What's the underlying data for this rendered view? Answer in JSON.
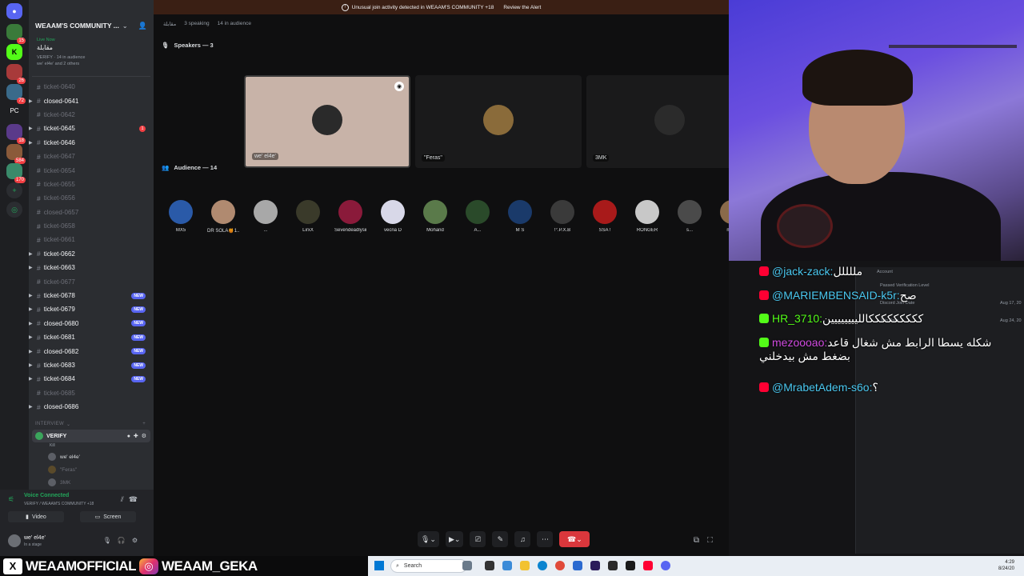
{
  "alert": {
    "text": "Unusual join activity detected in WEAAM'S COMMUNITY +18",
    "action": "Review the Alert"
  },
  "server": {
    "name": "WEAAM'S COMMUNITY ...",
    "live_label": "Live Now",
    "stage_name": "مقابلة",
    "live_meta": "VERIFY · 14 in audience",
    "live_people": "we' el4e' and 2 others"
  },
  "channels": [
    {
      "name": "ticket-0640",
      "bright": false,
      "arrow": false
    },
    {
      "name": "closed-0641",
      "bright": true,
      "arrow": true
    },
    {
      "name": "ticket-0642",
      "bright": false,
      "arrow": false
    },
    {
      "name": "ticket-0645",
      "bright": true,
      "arrow": true,
      "mention": "1"
    },
    {
      "name": "ticket-0646",
      "bright": true,
      "arrow": true
    },
    {
      "name": "ticket-0647",
      "bright": false,
      "arrow": false
    },
    {
      "name": "ticket-0654",
      "bright": false,
      "arrow": false
    },
    {
      "name": "ticket-0655",
      "bright": false,
      "arrow": false
    },
    {
      "name": "ticket-0656",
      "bright": false,
      "arrow": false
    },
    {
      "name": "closed-0657",
      "bright": false,
      "arrow": false
    },
    {
      "name": "ticket-0658",
      "bright": false,
      "arrow": false
    },
    {
      "name": "ticket-0661",
      "bright": false,
      "arrow": false
    },
    {
      "name": "ticket-0662",
      "bright": true,
      "arrow": true
    },
    {
      "name": "ticket-0663",
      "bright": true,
      "arrow": true
    },
    {
      "name": "ticket-0677",
      "bright": false,
      "arrow": false
    },
    {
      "name": "ticket-0678",
      "bright": true,
      "arrow": true,
      "new": "NEW"
    },
    {
      "name": "ticket-0679",
      "bright": true,
      "arrow": true,
      "new": "NEW"
    },
    {
      "name": "closed-0680",
      "bright": true,
      "arrow": true,
      "new": "NEW"
    },
    {
      "name": "ticket-0681",
      "bright": true,
      "arrow": true,
      "new": "NEW"
    },
    {
      "name": "closed-0682",
      "bright": true,
      "arrow": true,
      "new": "NEW"
    },
    {
      "name": "ticket-0683",
      "bright": true,
      "arrow": true,
      "new": "NEW"
    },
    {
      "name": "ticket-0684",
      "bright": true,
      "arrow": true,
      "new": "NEW"
    },
    {
      "name": "ticket-0685",
      "bright": false,
      "arrow": false
    },
    {
      "name": "closed-0686",
      "bright": true,
      "arrow": true
    }
  ],
  "category": "INTERVIEW",
  "voice_channel": {
    "name": "VERIFY",
    "sub": "Kill",
    "users": [
      "we' el4e'",
      "\"Feras\"",
      "3MK"
    ]
  },
  "voice_connected": {
    "status": "Voice Connected",
    "location": "VERIFY / WEAAM'S COMMUNITY +18",
    "video": "Video",
    "screen": "Screen"
  },
  "current_user": {
    "name": "we' el4e'",
    "status": "In a stage"
  },
  "stage": {
    "top_name": "مقابلة",
    "speaking": "3 speaking",
    "audience_count": "14 in audience",
    "speakers_title": "Speakers — 3",
    "audience_title": "Audience — 14",
    "speakers": [
      {
        "name": "we' el4e'",
        "active": true,
        "color": "#2a2a2a"
      },
      {
        "name": "\"Feras\"",
        "active": false,
        "color": "#8a6b3a"
      },
      {
        "name": "3MK",
        "active": false,
        "color": "#2b2b2b"
      }
    ],
    "audience": [
      {
        "name": "MX5",
        "color": "#2a5aa8"
      },
      {
        "name": "DR SOLA🍯1...",
        "color": "#b08a70"
      },
      {
        "name": "...",
        "color": "#a8a8a8"
      },
      {
        "name": "LirxX",
        "color": "#3a3a2a"
      },
      {
        "name": "Sevendeadlysin",
        "color": "#8a1a3a"
      },
      {
        "name": "vecna D",
        "color": "#d8d8e8"
      },
      {
        "name": "Mohand",
        "color": "#5a7a4a"
      },
      {
        "name": "A...",
        "color": "#2a4a2a"
      },
      {
        "name": "M S",
        "color": "#1a3a6a"
      },
      {
        "name": "!°.P.X.B",
        "color": "#3a3a3a"
      },
      {
        "name": "SSA !",
        "color": "#a81a1a"
      },
      {
        "name": "RONGER",
        "color": "#c8c8c8"
      },
      {
        "name": "s...",
        "color": "#4a4a4a"
      },
      {
        "name": "mo...",
        "color": "#8a6a4a"
      }
    ]
  },
  "chat": {
    "messages": [
      {
        "platform": "yt",
        "user": "@jack-zack:",
        "color": "#4ac8f0",
        "text": "مللللل"
      },
      {
        "platform": "yt",
        "user": "@MARIEMBENSAID-k5r:",
        "color": "#4ac8f0",
        "text": "صح"
      },
      {
        "platform": "kick",
        "user": "HR_3710:",
        "color": "#53fc18",
        "text": "كككككككككالليييييييين"
      },
      {
        "platform": "kick",
        "user": "mezoooao:",
        "color": "#d04ae0",
        "text": "شكله يسطا الرابط مش شغال قاعد بضغط مش بيدخلني"
      },
      {
        "platform": "yt",
        "user": "@MrabetAdem-s6o:",
        "color": "#4ac8f0",
        "text": "؟"
      }
    ],
    "panel_labels": [
      "Account",
      "Passed Verification Level",
      "Discord Join Date",
      "Aug 17, 20",
      "Join Date",
      "Aug 24, 20"
    ]
  },
  "social": {
    "x": "WEAAMOFFICIAL",
    "ig": "WEAAM_GEKA"
  },
  "taskbar": {
    "search": "Search",
    "time": "4:29",
    "date": "8/24/20"
  }
}
